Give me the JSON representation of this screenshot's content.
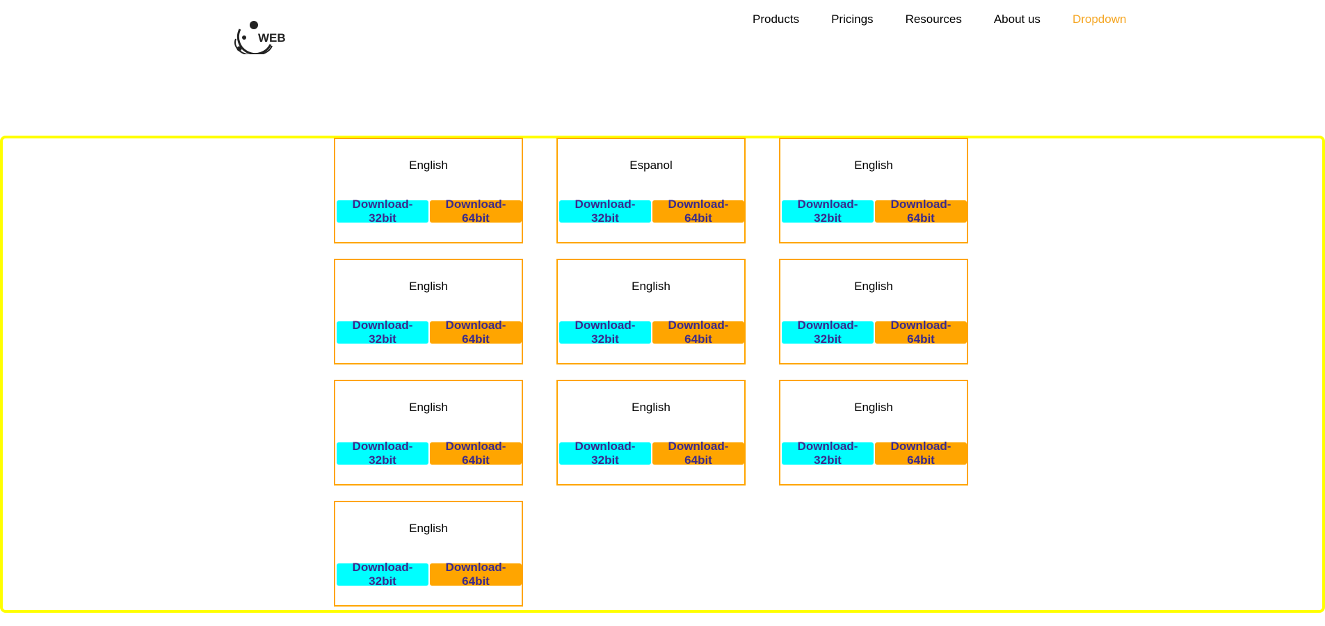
{
  "header": {
    "logo_text": "WEB",
    "nav": [
      {
        "label": "Products"
      },
      {
        "label": "Pricings"
      },
      {
        "label": "Resources"
      },
      {
        "label": "About us"
      },
      {
        "label": "Dropdown"
      }
    ]
  },
  "cards": [
    {
      "language": "English",
      "btn32": "Download-32bit",
      "btn64": "Download-64bit"
    },
    {
      "language": "Espanol",
      "btn32": "Download-32bit",
      "btn64": "Download-64bit"
    },
    {
      "language": "English",
      "btn32": "Download-32bit",
      "btn64": "Download-64bit"
    },
    {
      "language": "English",
      "btn32": "Download-32bit",
      "btn64": "Download-64bit"
    },
    {
      "language": "English",
      "btn32": "Download-32bit",
      "btn64": "Download-64bit"
    },
    {
      "language": "English",
      "btn32": "Download-32bit",
      "btn64": "Download-64bit"
    },
    {
      "language": "English",
      "btn32": "Download-32bit",
      "btn64": "Download-64bit"
    },
    {
      "language": "English",
      "btn32": "Download-32bit",
      "btn64": "Download-64bit"
    },
    {
      "language": "English",
      "btn32": "Download-32bit",
      "btn64": "Download-64bit"
    },
    {
      "language": "English",
      "btn32": "Download-32bit",
      "btn64": "Download-64bit"
    }
  ],
  "colors": {
    "frame_border": "#ffff00",
    "card_border": "#ffa500",
    "btn32_bg": "#00ffff",
    "btn64_bg": "#ffa500",
    "dropdown_text": "#f5a623"
  }
}
